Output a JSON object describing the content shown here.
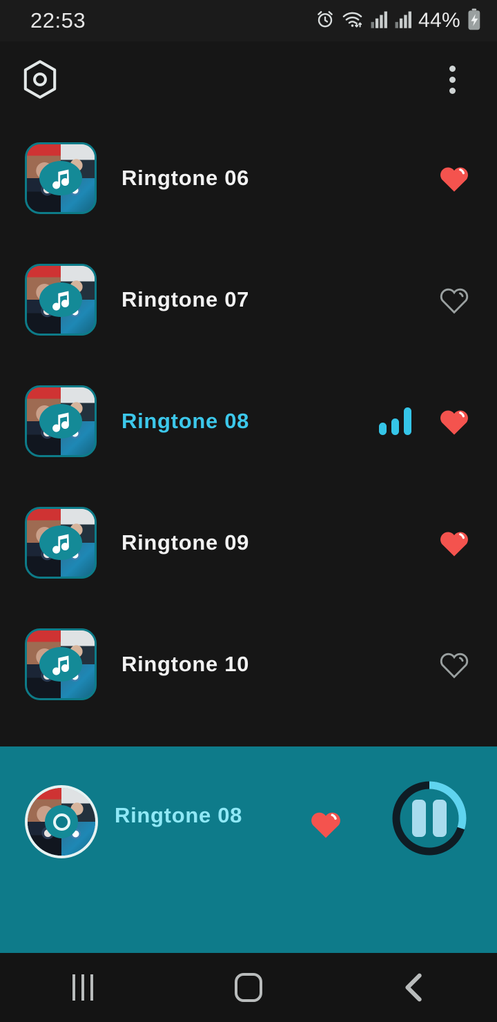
{
  "status_bar": {
    "time": "22:53",
    "battery_percent": "44%",
    "icons": [
      "alarm-icon",
      "wifi-icon",
      "signal-icon",
      "signal-icon",
      "battery-charging-icon"
    ]
  },
  "app_bar": {
    "logo_icon": "hexagon-logo-icon",
    "overflow_icon": "more-vertical-icon"
  },
  "theme": {
    "background": "#161616",
    "accent_teal": "#0e7b8a",
    "accent_cyan": "#3cc7ea",
    "heart_red": "#f4534e",
    "heart_outline": "#9aa0a0",
    "title_text": "#f2f2f2",
    "player_title_text": "#8fe8f6"
  },
  "ringtone_list": {
    "items": [
      {
        "title": "Ringtone 06",
        "favorite": true,
        "playing": false
      },
      {
        "title": "Ringtone 07",
        "favorite": false,
        "playing": false
      },
      {
        "title": "Ringtone 08",
        "favorite": true,
        "playing": true
      },
      {
        "title": "Ringtone 09",
        "favorite": true,
        "playing": false
      },
      {
        "title": "Ringtone 10",
        "favorite": false,
        "playing": false
      }
    ]
  },
  "player": {
    "title": "Ringtone 08",
    "favorite": true,
    "state": "playing",
    "button_icon": "pause-icon",
    "progress_percent": 30,
    "cover_icon": "album-art"
  },
  "nav_bar": {
    "recents_label": "recents-icon",
    "home_label": "home-icon",
    "back_label": "back-icon"
  }
}
